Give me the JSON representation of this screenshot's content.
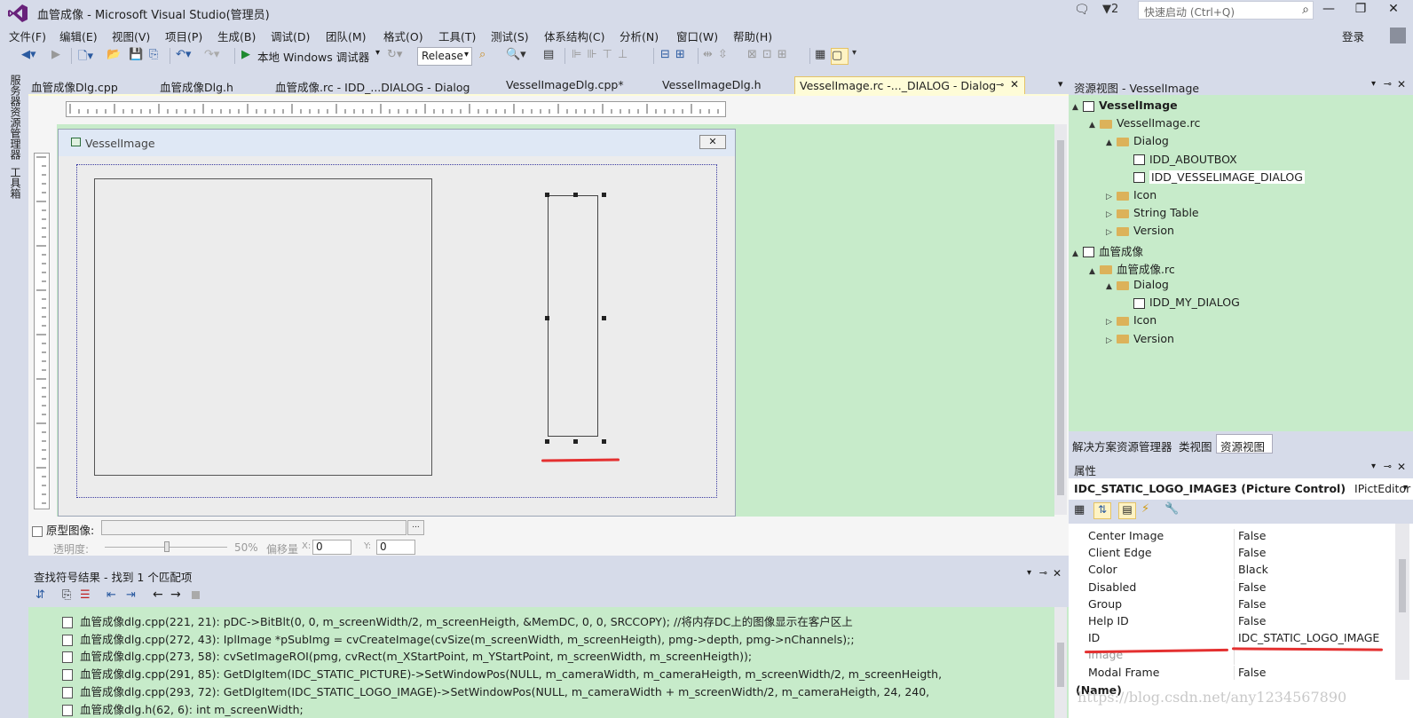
{
  "window": {
    "title": "血管成像 - Microsoft Visual Studio(管理员)",
    "notify_count": "2",
    "quick_launch_placeholder": "快速启动 (Ctrl+Q)",
    "login": "登录"
  },
  "menu": [
    "文件(F)",
    "编辑(E)",
    "视图(V)",
    "项目(P)",
    "生成(B)",
    "调试(D)",
    "团队(M)",
    "格式(O)",
    "工具(T)",
    "测试(S)",
    "体系结构(C)",
    "分析(N)",
    "窗口(W)",
    "帮助(H)"
  ],
  "toolbar": {
    "debugger_label": "本地 Windows 调试器",
    "config": "Release"
  },
  "side_tabs": [
    "服务器资源管理器",
    "工具箱"
  ],
  "doc_tabs": [
    "血管成像Dlg.cpp",
    "血管成像Dlg.h",
    "血管成像.rc - IDD_...DIALOG - Dialog",
    "VesselImageDlg.cpp*",
    "VesselImageDlg.h"
  ],
  "active_tab": "VesselImage.rc -..._DIALOG - Dialog",
  "dialog": {
    "title": "VesselImage"
  },
  "prototype": {
    "checkbox_label": "原型图像:",
    "opacity_label": "透明度:",
    "opacity_value": "50%",
    "offset_label": "偏移量",
    "x_label": "X:",
    "x_value": "0",
    "y_label": "Y:",
    "y_value": "0"
  },
  "find_results": {
    "title": "查找符号结果 - 找到 1 个匹配项",
    "lines": [
      "血管成像dlg.cpp(221, 21): pDC->BitBlt(0, 0, m_screenWidth/2, m_screenHeigth, &MemDC, 0, 0, SRCCOPY); //将内存DC上的图像显示在客户区上",
      "血管成像dlg.cpp(272, 43): IplImage *pSubImg = cvCreateImage(cvSize(m_screenWidth, m_screenHeigth), pmg->depth, pmg->nChannels);;",
      "血管成像dlg.cpp(273, 58): cvSetImageROI(pmg, cvRect(m_XStartPoint, m_YStartPoint, m_screenWidth, m_screenHeigth));",
      "血管成像dlg.cpp(291, 85): GetDlgItem(IDC_STATIC_PICTURE)->SetWindowPos(NULL, m_cameraWidth, m_cameraHeigth, m_screenWidth/2, m_screenHeigth,",
      "血管成像dlg.cpp(293, 72): GetDlgItem(IDC_STATIC_LOGO_IMAGE)->SetWindowPos(NULL, m_cameraWidth + m_screenWidth/2, m_cameraHeigth, 24, 240,",
      "血管成像dlg.h(62, 6): int m_screenWidth;"
    ]
  },
  "resource_view": {
    "title": "资源视图 - VesselImage",
    "tree": [
      {
        "label": "VesselImage",
        "bold": true
      },
      {
        "label": "VesselImage.rc"
      },
      {
        "label": "Dialog"
      },
      {
        "label": "IDD_ABOUTBOX"
      },
      {
        "label": "IDD_VESSELIMAGE_DIALOG"
      },
      {
        "label": "Icon"
      },
      {
        "label": "String Table"
      },
      {
        "label": "Version"
      },
      {
        "label": "血管成像"
      },
      {
        "label": "血管成像.rc"
      },
      {
        "label": "Dialog"
      },
      {
        "label": "IDD_MY_DIALOG"
      },
      {
        "label": "Icon"
      },
      {
        "label": "Version"
      }
    ],
    "bottom_tabs": [
      "解决方案资源管理器",
      "类视图",
      "资源视图"
    ]
  },
  "properties": {
    "title": "属性",
    "selected_object": "IDC_STATIC_LOGO_IMAGE3 (Picture Control)",
    "selected_type": "IPictEditor",
    "rows": [
      {
        "key": "Center Image",
        "value": "False"
      },
      {
        "key": "Client Edge",
        "value": "False"
      },
      {
        "key": "Color",
        "value": "Black"
      },
      {
        "key": "Disabled",
        "value": "False"
      },
      {
        "key": "Group",
        "value": "False"
      },
      {
        "key": "Help ID",
        "value": "False"
      },
      {
        "key": "ID",
        "value": "IDC_STATIC_LOGO_IMAGE"
      },
      {
        "key": "Image",
        "value": ""
      },
      {
        "key": "Modal Frame",
        "value": "False"
      }
    ],
    "footer": "(Name)"
  },
  "watermark": "https://blog.csdn.net/any1234567890",
  "colors": {
    "designer_bg": "#c7ebca",
    "chrome": "#d6dbe9",
    "annotation_red": "#e43030"
  }
}
